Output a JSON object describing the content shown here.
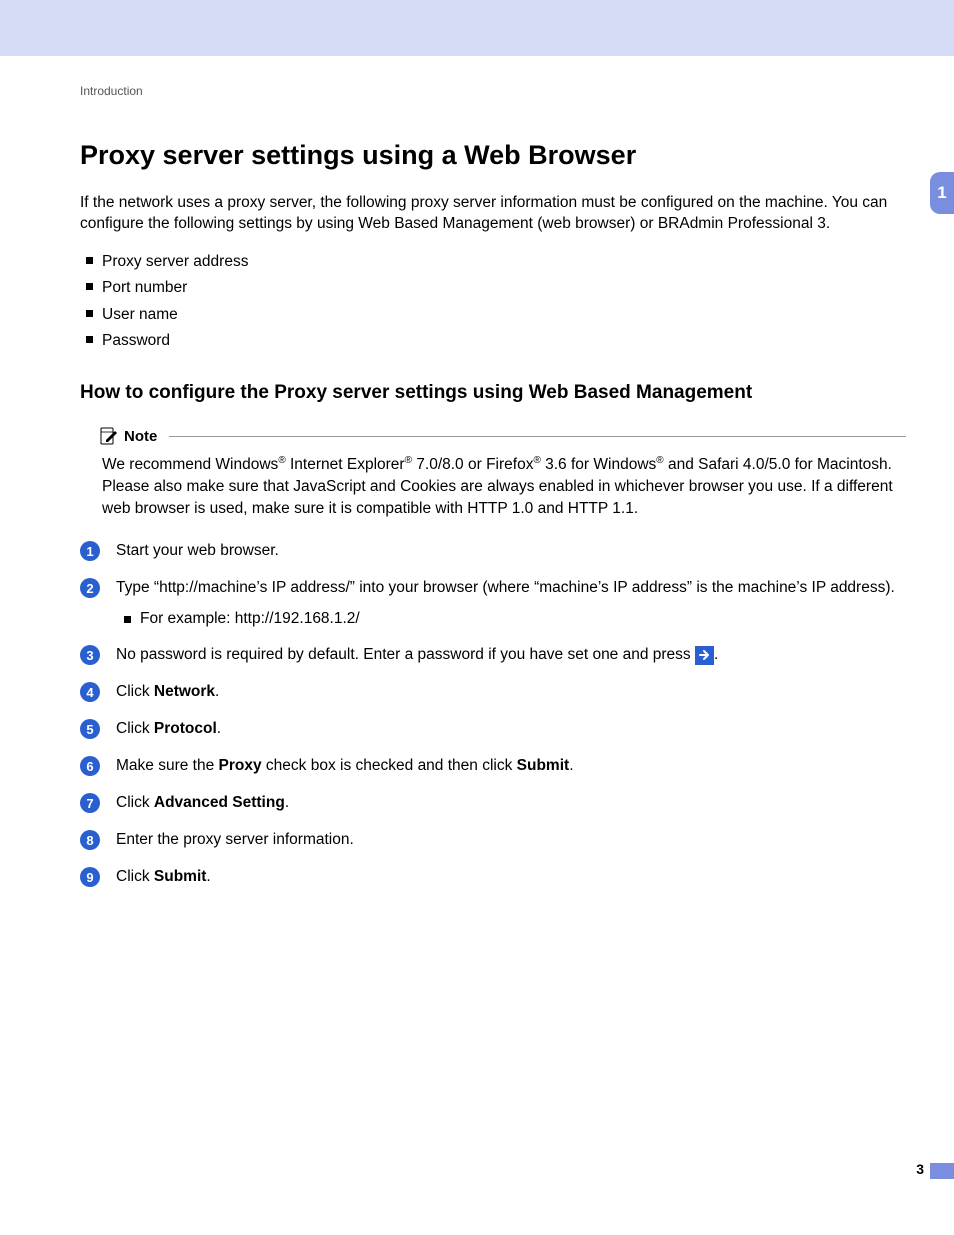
{
  "breadcrumb": "Introduction",
  "side_tab": "1",
  "page_number": "3",
  "h1": "Proxy server settings using a Web Browser",
  "intro": "If the network uses a proxy server, the following proxy server information must be configured on the machine. You can configure the following settings by using Web Based Management (web browser) or BRAdmin Professional 3.",
  "bullets": [
    "Proxy server address",
    "Port number",
    "User name",
    "Password"
  ],
  "h2": "How to configure the Proxy server settings using Web Based Management",
  "note_label": "Note",
  "note_parts": {
    "p1": "We recommend Windows",
    "p2": " Internet Explorer",
    "p3": " 7.0/8.0 or Firefox",
    "p4": " 3.6 for Windows",
    "p5": " and Safari 4.0/5.0 for Macintosh. Please also make sure that JavaScript and Cookies are always enabled in whichever browser you use. If a different web browser is used, make sure it is compatible with HTTP 1.0 and HTTP 1.1.",
    "reg": "®"
  },
  "steps": {
    "s1": "Start your web browser.",
    "s2": "Type “http://machine’s IP address/” into your browser (where “machine’s IP address” is the machine’s IP address).",
    "s2_sub": "For example: http://192.168.1.2/",
    "s3_a": "No password is required by default. Enter a password if you have set one and press ",
    "s3_b": ".",
    "s4_a": "Click ",
    "s4_b": "Network",
    "s4_c": ".",
    "s5_a": "Click ",
    "s5_b": "Protocol",
    "s5_c": ".",
    "s6_a": "Make sure the ",
    "s6_b": "Proxy",
    "s6_c": " check box is checked and then click ",
    "s6_d": "Submit",
    "s6_e": ".",
    "s7_a": "Click ",
    "s7_b": "Advanced Setting",
    "s7_c": ".",
    "s8": "Enter the proxy server information.",
    "s9_a": "Click ",
    "s9_b": "Submit",
    "s9_c": "."
  },
  "step_numbers": [
    "1",
    "2",
    "3",
    "4",
    "5",
    "6",
    "7",
    "8",
    "9"
  ]
}
